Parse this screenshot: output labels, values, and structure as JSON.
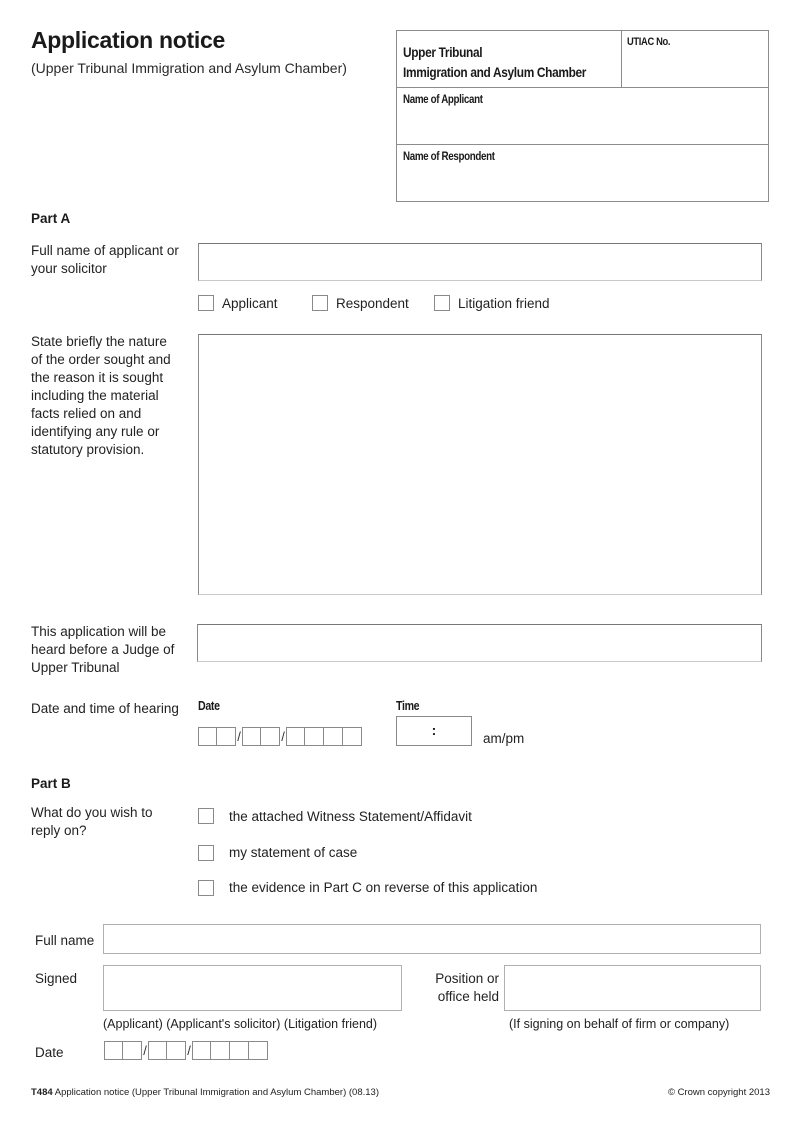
{
  "header": {
    "title": "Application notice",
    "subtitle": "(Upper Tribunal Immigration and Asylum Chamber)",
    "court_box": {
      "court_line1": "Upper Tribunal",
      "court_line2": "Immigration and Asylum Chamber",
      "utiac_label": "UTIAC No.",
      "utiac_value": "",
      "applicant_label": "Name of Applicant",
      "applicant_value": "",
      "respondent_label": "Name of Respondent",
      "respondent_value": ""
    }
  },
  "part_a": {
    "heading": "Part A",
    "full_name": {
      "label_line1": "Full name of applicant or",
      "label_line2": "your solicitor",
      "value": ""
    },
    "role_options": [
      {
        "label": "Applicant",
        "checked": false
      },
      {
        "label": "Respondent",
        "checked": false
      },
      {
        "label": "Litigation friend",
        "checked": false
      }
    ],
    "order_sought": {
      "label_lines": [
        "State briefly the nature",
        "of the order sought and",
        "the reason it is sought",
        "including the material",
        "facts relied on and",
        "identifying any rule or",
        "statutory provision."
      ],
      "value": ""
    },
    "judge": {
      "label_lines": [
        "This application will be",
        "heard before a Judge of",
        "Upper Tribunal"
      ],
      "value": ""
    },
    "hearing": {
      "label": "Date and time of hearing",
      "date_label": "Date",
      "date_separator": "/",
      "time_label": "Time",
      "time_separator": ":",
      "ampm_label": "am/pm"
    }
  },
  "part_b": {
    "heading": "Part B",
    "question_line1": "What do you wish to",
    "question_line2": "reply on?",
    "options": [
      {
        "label": "the attached Witness Statement/Affidavit",
        "checked": false
      },
      {
        "label": "my statement of case",
        "checked": false
      },
      {
        "label": "the evidence in Part C on reverse of this application",
        "checked": false
      }
    ]
  },
  "signature": {
    "full_name_label": "Full name",
    "full_name_value": "",
    "signed_label": "Signed",
    "signed_caption": "(Applicant) (Applicant's solicitor) (Litigation friend)",
    "position_label_line1": "Position or",
    "position_label_line2": "office held",
    "position_caption": "(If signing on behalf of firm or company)",
    "date_label": "Date",
    "date_separator": "/"
  },
  "footer": {
    "form_code": "T484",
    "form_title": " Application notice (Upper Tribunal Immigration and Asylum Chamber) (08.13)",
    "copyright": "© Crown copyright 2013"
  }
}
